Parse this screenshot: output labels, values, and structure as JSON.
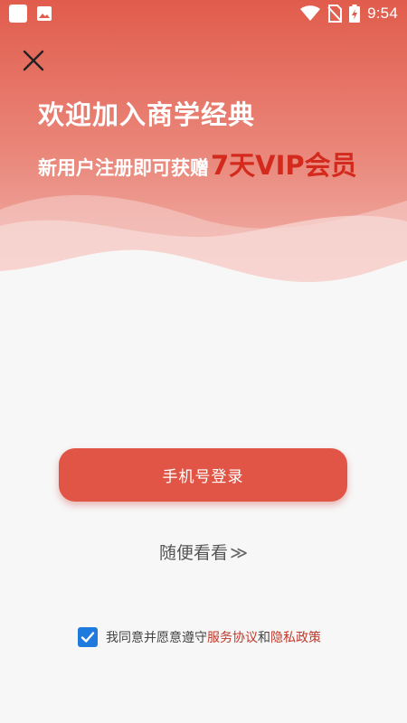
{
  "status_bar": {
    "time": "9:54",
    "icons": [
      "app-square-icon",
      "image-icon",
      "wifi-icon",
      "no-sim-icon",
      "battery-charging-icon"
    ]
  },
  "header": {
    "close_icon": "close-icon",
    "title": "欢迎加入商学经典",
    "subtitle_lead": "新用户注册即可获赠",
    "subtitle_highlight": "7天VIP会员"
  },
  "actions": {
    "phone_login_label": "手机号登录",
    "browse_label": "随便看看",
    "browse_arrows": "≫"
  },
  "agreement": {
    "checked": true,
    "prefix": "我同意并愿意遵守",
    "service_link": "服务协议",
    "joiner": "和",
    "privacy_link": "隐私政策"
  },
  "colors": {
    "header_gradient_top": "#e15c4c",
    "header_gradient_bottom": "#f0b3ab",
    "primary_button": "#e05546",
    "highlight_text": "#d32a1d",
    "link_text": "#c0392b",
    "checkbox": "#1e7bdd",
    "background": "#f7f7f7"
  }
}
